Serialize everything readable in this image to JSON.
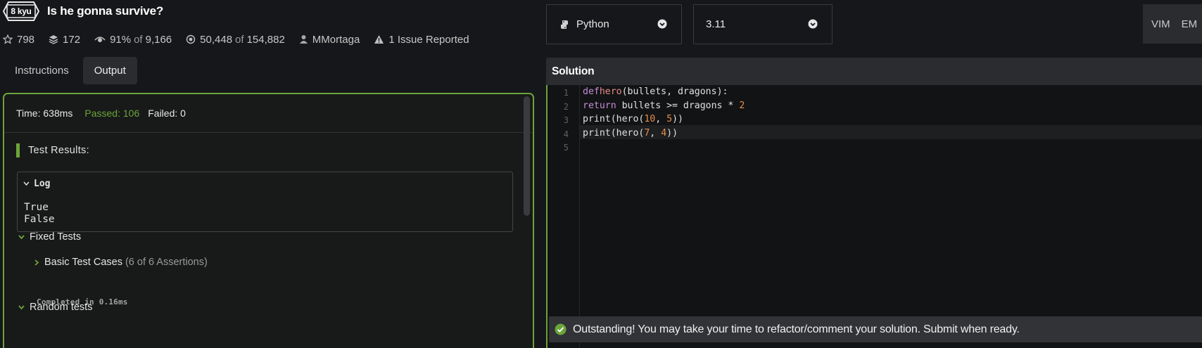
{
  "kata": {
    "rank": "8 kyu",
    "title": "Is he gonna survive?",
    "stats": {
      "stars": "798",
      "collections": "172",
      "satisfaction": "91%",
      "satisfaction_of": "of",
      "votes": "9,166",
      "completed": "50,448",
      "completed_of": "of",
      "attempts": "154,882",
      "author": "MMortaga",
      "issues": "1 Issue Reported"
    }
  },
  "tabs": [
    {
      "label": "Instructions",
      "active": false
    },
    {
      "label": "Output",
      "active": true
    }
  ],
  "output": {
    "time": "Time: 638ms",
    "passed": "Passed: 106",
    "failed": "Failed: 0",
    "results_title": "Test Results:",
    "log_label": "Log",
    "log_lines": [
      "True",
      "False"
    ],
    "fixed_tests": "Fixed Tests",
    "basic_cases": "Basic Test Cases",
    "basic_assertions": "(6 of 6 Assertions)",
    "completed_in": "Completed in 0.16ms",
    "random_tests": "Random tests"
  },
  "toolbar": {
    "language": "Python",
    "version": "3.11",
    "mode": "VIM",
    "mode2": "EM"
  },
  "solution": {
    "title": "Solution",
    "line_numbers": [
      "1",
      "2",
      "3",
      "4",
      "5"
    ],
    "status_message": "Outstanding! You may take your time to refactor/comment your solution. Submit when ready."
  },
  "colors": {
    "accent": "#6ba53a",
    "background": "#16171a",
    "panel": "#2b2c2f"
  }
}
